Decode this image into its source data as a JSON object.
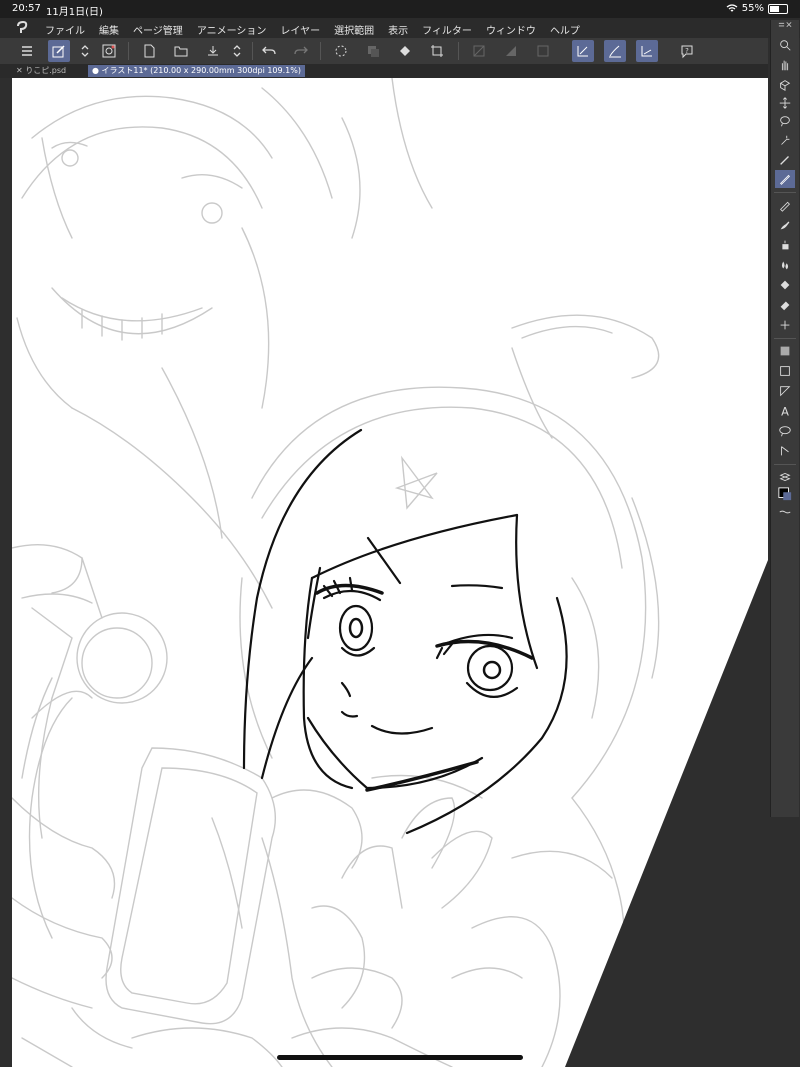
{
  "status": {
    "time": "20:57",
    "date": "11月1日(日)",
    "battery": "55%",
    "battery_level": 0.55
  },
  "menu": {
    "items": [
      "ファイル",
      "編集",
      "ページ管理",
      "アニメーション",
      "レイヤー",
      "選択範囲",
      "表示",
      "フィルター",
      "ウィンドウ",
      "ヘルプ"
    ]
  },
  "tabs": [
    {
      "label": "✕ りこピ.psd"
    },
    {
      "label": "● イラスト11* (210.00 x 290.00mm 300dpi 109.1%)"
    }
  ],
  "colors": {
    "accent": "#5c6a96",
    "canvas": "#ffffff",
    "workspace": "#2e2e2e",
    "toolbar": "#3a3a3a"
  },
  "toolbar_icons": [
    "menu-icon",
    "layer-edit-icon",
    "stepper-icon",
    "spiral-icon",
    "new-file-icon",
    "open-folder-icon",
    "save-icon",
    "stepper-icon",
    "undo-icon",
    "redo-icon",
    "loading-icon",
    "layer-copy-icon",
    "fill-icon",
    "transform-icon",
    "clear-icon",
    "tone-icon",
    "frame-icon",
    "ruler-icon",
    "brush-snap-icon",
    "ruler-snap-icon",
    "help-icon"
  ],
  "tool_icons": [
    "zoom-icon",
    "hand-icon",
    "rotate-icon",
    "move-icon",
    "lasso-icon",
    "magic-wand-icon",
    "eyedropper-icon",
    "pen-icon",
    "pencil-icon",
    "brush-icon",
    "airbrush-icon",
    "blend-icon",
    "fill-icon",
    "eraser-icon",
    "decoration-icon",
    "gradient-icon",
    "rectangle-icon",
    "figure-icon",
    "text-icon",
    "balloon-icon",
    "correction-icon",
    "layers-icon",
    "color-icon",
    "ruler-icon"
  ]
}
